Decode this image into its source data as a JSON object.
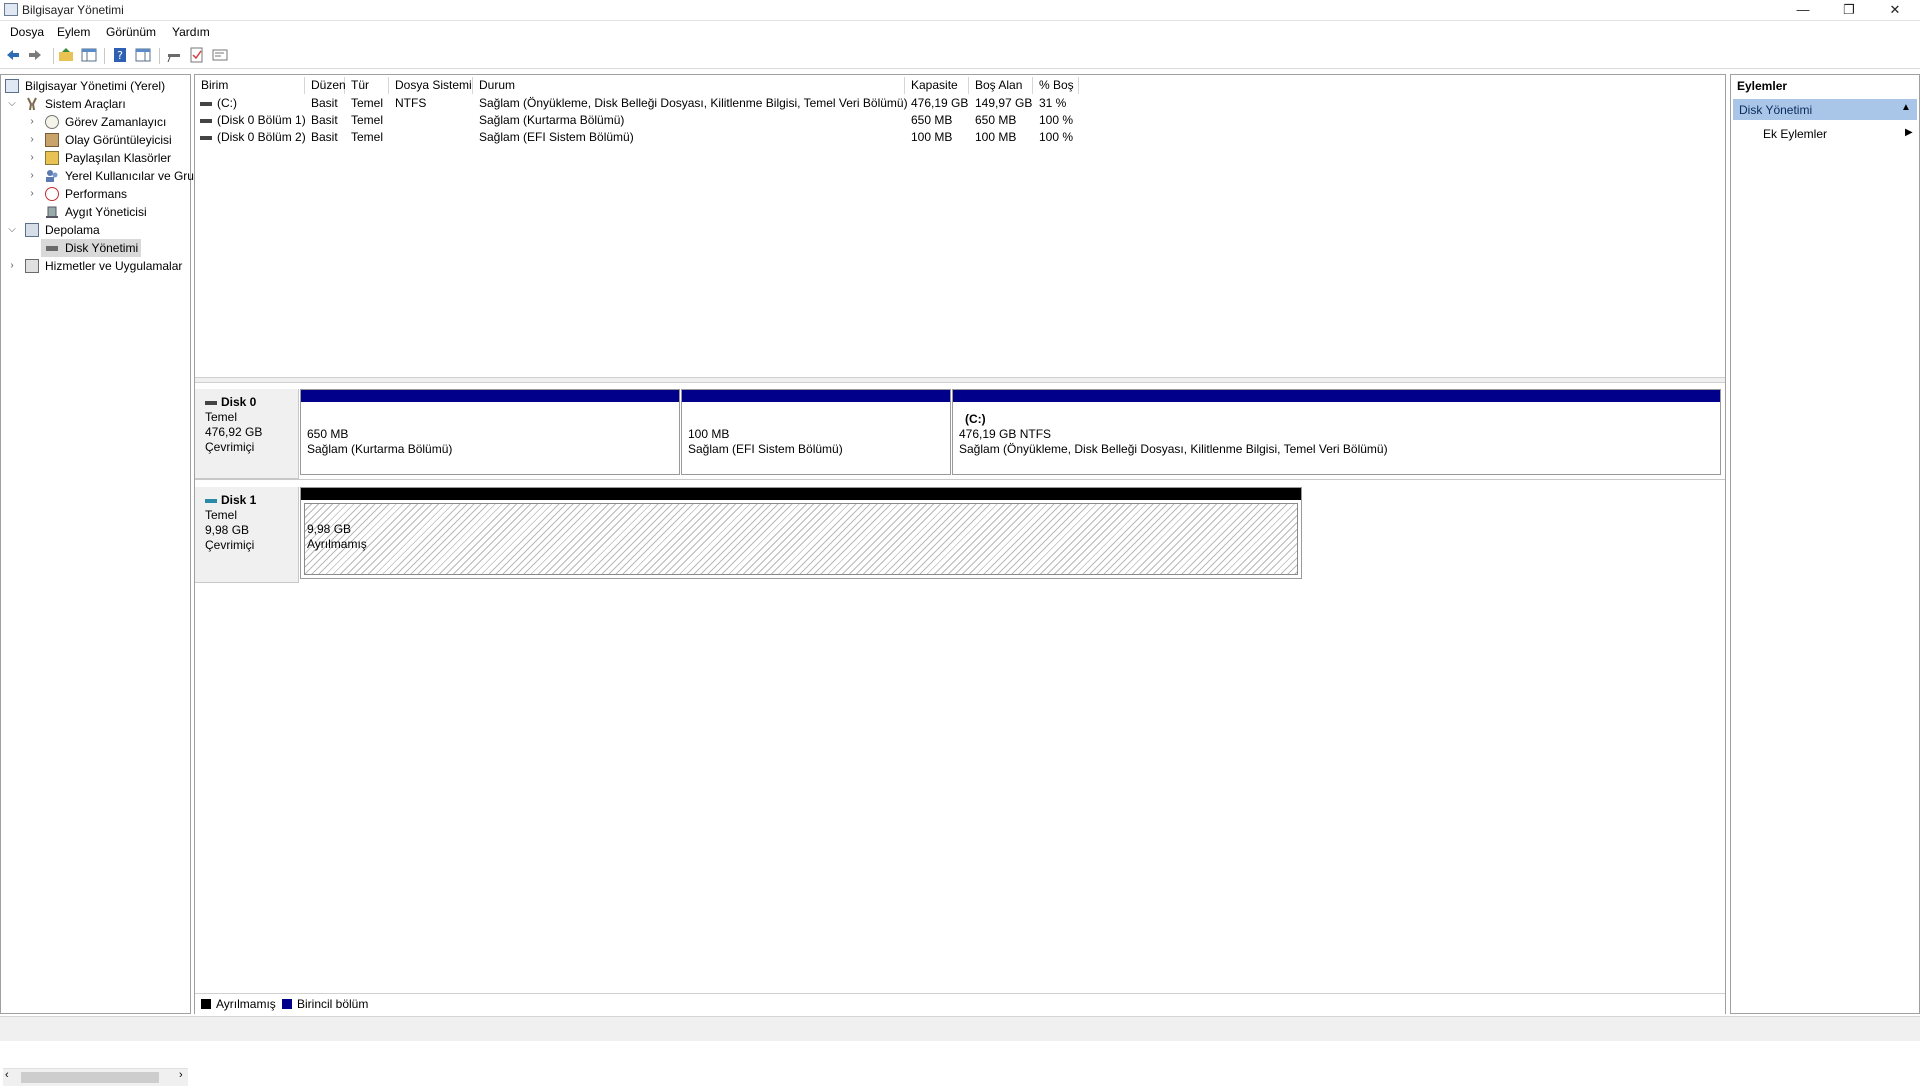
{
  "window": {
    "title": "Bilgisayar Yönetimi",
    "controls": {
      "minimize": "—",
      "restore": "❐",
      "close": "✕"
    }
  },
  "menu": [
    "Dosya",
    "Eylem",
    "Görünüm",
    "Yardım"
  ],
  "toolbar": {
    "icons": [
      "back-arrow-icon",
      "forward-arrow-icon",
      "up-folder-icon",
      "show-tree-icon",
      "help-icon",
      "properties-pane-icon",
      "connect-icon",
      "checklist-icon",
      "console-icon"
    ]
  },
  "tree": {
    "root": "Bilgisayar Yönetimi (Yerel)",
    "system_tools": "Sistem Araçları",
    "task_scheduler": "Görev Zamanlayıcı",
    "event_viewer": "Olay Görüntüleyicisi",
    "shared_folders": "Paylaşılan Klasörler",
    "local_users": "Yerel Kullanıcılar ve Gru",
    "performance": "Performans",
    "device_manager": "Aygıt Yöneticisi",
    "storage": "Depolama",
    "disk_management": "Disk Yönetimi",
    "services": "Hizmetler ve Uygulamalar"
  },
  "volume_table": {
    "columns": [
      "Birim",
      "Düzen",
      "Tür",
      "Dosya Sistemi",
      "Durum",
      "Kapasite",
      "Boş Alan",
      "% Boş"
    ],
    "rows": [
      {
        "volume": "(C:)",
        "layout": "Basit",
        "type": "Temel",
        "fs": "NTFS",
        "status": "Sağlam (Önyükleme, Disk Belleği Dosyası, Kilitlenme Bilgisi, Temel Veri Bölümü)",
        "capacity": "476,19 GB",
        "free": "149,97 GB",
        "pct": "31 %"
      },
      {
        "volume": "(Disk 0 Bölüm 1)",
        "layout": "Basit",
        "type": "Temel",
        "fs": "",
        "status": "Sağlam (Kurtarma Bölümü)",
        "capacity": "650 MB",
        "free": "650 MB",
        "pct": "100 %"
      },
      {
        "volume": "(Disk 0 Bölüm 2)",
        "layout": "Basit",
        "type": "Temel",
        "fs": "",
        "status": "Sağlam (EFI Sistem Bölümü)",
        "capacity": "100 MB",
        "free": "100 MB",
        "pct": "100 %"
      }
    ]
  },
  "disks": [
    {
      "name": "Disk 0",
      "kind": "Temel",
      "size": "476,92 GB",
      "state": "Çevrimiçi",
      "partitions": [
        {
          "label": "",
          "size": "650 MB",
          "status": "Sağlam (Kurtarma Bölümü)"
        },
        {
          "label": "",
          "size": "100 MB",
          "status": "Sağlam (EFI Sistem Bölümü)"
        },
        {
          "label": "(C:)",
          "size": "476,19 GB NTFS",
          "status": "Sağlam (Önyükleme, Disk Belleği Dosyası, Kilitlenme Bilgisi, Temel Veri Bölümü)"
        }
      ]
    },
    {
      "name": "Disk 1",
      "kind": "Temel",
      "size": "9,98 GB",
      "state": "Çevrimiçi",
      "partitions": [
        {
          "size": "9,98 GB",
          "status": "Ayrılmamış"
        }
      ]
    }
  ],
  "legend": {
    "unallocated": "Ayrılmamış",
    "primary": "Birincil bölüm"
  },
  "colors": {
    "primary_partition": "#00008b",
    "unallocated": "#000000",
    "actions_header": "#a9c6e8"
  },
  "actions": {
    "title": "Eylemler",
    "section": "Disk Yönetimi",
    "item": "Ek Eylemler"
  }
}
